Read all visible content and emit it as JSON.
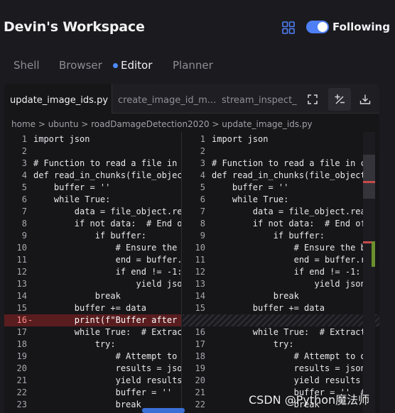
{
  "header": {
    "title": "Devin's Workspace",
    "following_label": "Following",
    "following_on": true,
    "accent": "#4f7ff5"
  },
  "tabs": [
    {
      "label": "Shell",
      "active": false
    },
    {
      "label": "Browser",
      "active": false
    },
    {
      "label": "Editor",
      "active": true
    },
    {
      "label": "Planner",
      "active": false
    }
  ],
  "editor": {
    "file_tabs": [
      {
        "label": "update_image_ids.py",
        "active": true
      },
      {
        "label": "create_image_id_m...",
        "active": false
      },
      {
        "label": "stream_inspect_",
        "active": false
      }
    ],
    "toolbar_icons": [
      "fullscreen-icon",
      "diff-toggle-icon",
      "download-icon"
    ],
    "breadcrumb": [
      "home",
      "ubuntu",
      "roadDamageDetection2020",
      "update_image_ids.py"
    ],
    "breadcrumb_text": "home > ubuntu > roadDamageDetection2020 > update_image_ids.py",
    "left_lines": [
      {
        "n": "1",
        "code": "import json",
        "type": "normal"
      },
      {
        "n": "2",
        "code": "",
        "type": "normal"
      },
      {
        "n": "3",
        "code": "# Function to read a file in ch",
        "type": "normal"
      },
      {
        "n": "4",
        "code": "def read_in_chunks(file_object,",
        "type": "normal"
      },
      {
        "n": "5",
        "code": "    buffer = ''",
        "type": "normal"
      },
      {
        "n": "6",
        "code": "    while True:",
        "type": "normal"
      },
      {
        "n": "7",
        "code": "        data = file_object.read",
        "type": "normal"
      },
      {
        "n": "8",
        "code": "        if not data:  # End of",
        "type": "normal"
      },
      {
        "n": "9",
        "code": "            if buffer:",
        "type": "normal"
      },
      {
        "n": "10",
        "code": "                # Ensure the bu",
        "type": "normal"
      },
      {
        "n": "11",
        "code": "                end = buffer.rf",
        "type": "normal"
      },
      {
        "n": "12",
        "code": "                if end != -1:",
        "type": "normal"
      },
      {
        "n": "13",
        "code": "                    yield json.",
        "type": "normal"
      },
      {
        "n": "14",
        "code": "            break",
        "type": "normal"
      },
      {
        "n": "15",
        "code": "        buffer += data",
        "type": "normal"
      },
      {
        "n": "16",
        "code": "        print(f\"Buffer after re",
        "type": "removed"
      },
      {
        "n": "17",
        "code": "        while True:  # Extract",
        "type": "normal"
      },
      {
        "n": "18",
        "code": "            try:",
        "type": "normal"
      },
      {
        "n": "19",
        "code": "                # Attempt to de",
        "type": "normal"
      },
      {
        "n": "20",
        "code": "                results = json.",
        "type": "normal"
      },
      {
        "n": "21",
        "code": "                yield results",
        "type": "normal"
      },
      {
        "n": "22",
        "code": "                buffer = ''  #",
        "type": "normal"
      },
      {
        "n": "23",
        "code": "                break",
        "type": "normal"
      }
    ],
    "right_lines": [
      {
        "n": "1",
        "code": "import json",
        "type": "normal"
      },
      {
        "n": "2",
        "code": "",
        "type": "normal"
      },
      {
        "n": "3",
        "code": "# Function to read a file in ch",
        "type": "normal"
      },
      {
        "n": "4",
        "code": "def read_in_chunks(file_object,",
        "type": "normal"
      },
      {
        "n": "5",
        "code": "    buffer = ''",
        "type": "normal"
      },
      {
        "n": "6",
        "code": "    while True:",
        "type": "normal"
      },
      {
        "n": "7",
        "code": "        data = file_object.read",
        "type": "normal"
      },
      {
        "n": "8",
        "code": "        if not data:  # End of",
        "type": "normal"
      },
      {
        "n": "9",
        "code": "            if buffer:",
        "type": "normal"
      },
      {
        "n": "10",
        "code": "                # Ensure the bu",
        "type": "normal"
      },
      {
        "n": "11",
        "code": "                end = buffer.rf",
        "type": "normal"
      },
      {
        "n": "12",
        "code": "                if end != -1:",
        "type": "normal"
      },
      {
        "n": "13",
        "code": "                    yield json.",
        "type": "normal"
      },
      {
        "n": "14",
        "code": "            break",
        "type": "normal"
      },
      {
        "n": "15",
        "code": "        buffer += data",
        "type": "normal"
      },
      {
        "n": "",
        "code": "",
        "type": "placeholder"
      },
      {
        "n": "16",
        "code": "        while True:  # Extract",
        "type": "normal"
      },
      {
        "n": "17",
        "code": "            try:",
        "type": "normal"
      },
      {
        "n": "18",
        "code": "                # Attempt to de",
        "type": "normal"
      },
      {
        "n": "19",
        "code": "                results = json.",
        "type": "normal"
      },
      {
        "n": "20",
        "code": "                yield results",
        "type": "normal"
      },
      {
        "n": "21",
        "code": "                buffer = ''  #",
        "type": "normal"
      },
      {
        "n": "22",
        "code": "                break",
        "type": "normal"
      }
    ]
  },
  "colors": {
    "removed_line_bg": "#5a1d1f",
    "diff_marker_red": "#c84a4a",
    "diff_marker_green": "#6a8f2e"
  },
  "watermark": "CSDN @Python魔法师"
}
